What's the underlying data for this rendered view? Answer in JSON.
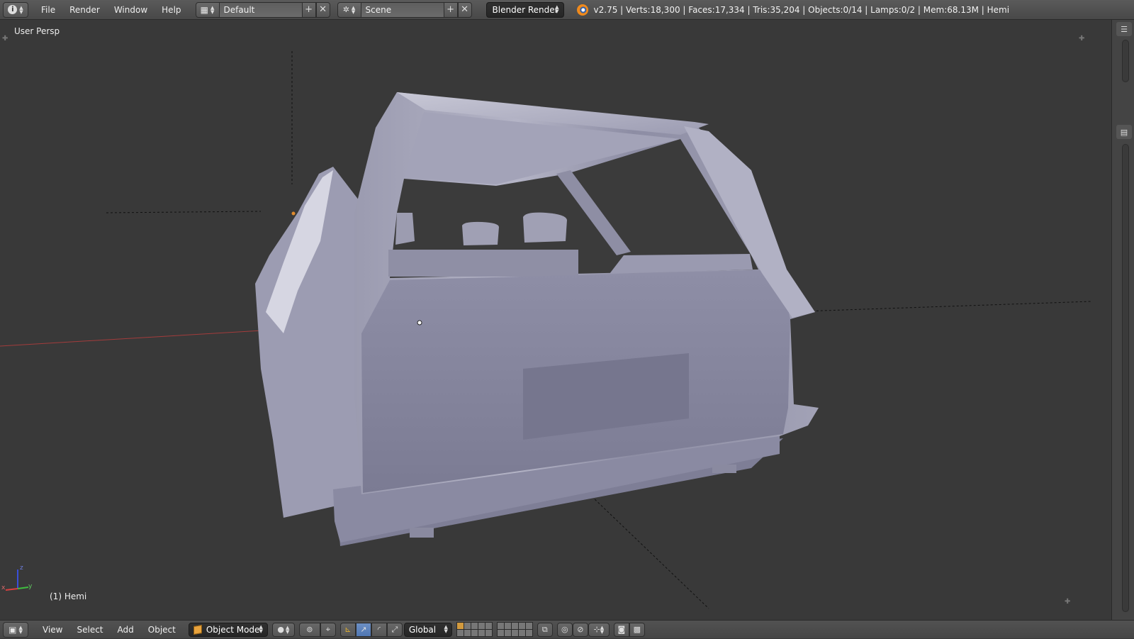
{
  "top_bar": {
    "menus": [
      "File",
      "Render",
      "Window",
      "Help"
    ],
    "screen_layout": "Default",
    "scene": "Scene",
    "render_engine": "Blender Render",
    "stats": "v2.75 | Verts:18,300 | Faces:17,334 | Tris:35,204 | Objects:0/14 | Lamps:0/2 | Mem:68.13M | Hemi"
  },
  "viewport": {
    "view_name": "User Persp",
    "object_info": "(1) Hemi",
    "axis_labels": {
      "x": "x",
      "y": "y",
      "z": "z"
    }
  },
  "bottom_bar": {
    "menus": [
      "View",
      "Select",
      "Add",
      "Object"
    ],
    "mode": "Object Mode",
    "orientation": "Global"
  },
  "colors": {
    "background": "#393939",
    "header": "#4e4e4e",
    "model": "#8a8aa0",
    "x_axis": "#c0392b",
    "accent": "#5680c2"
  }
}
